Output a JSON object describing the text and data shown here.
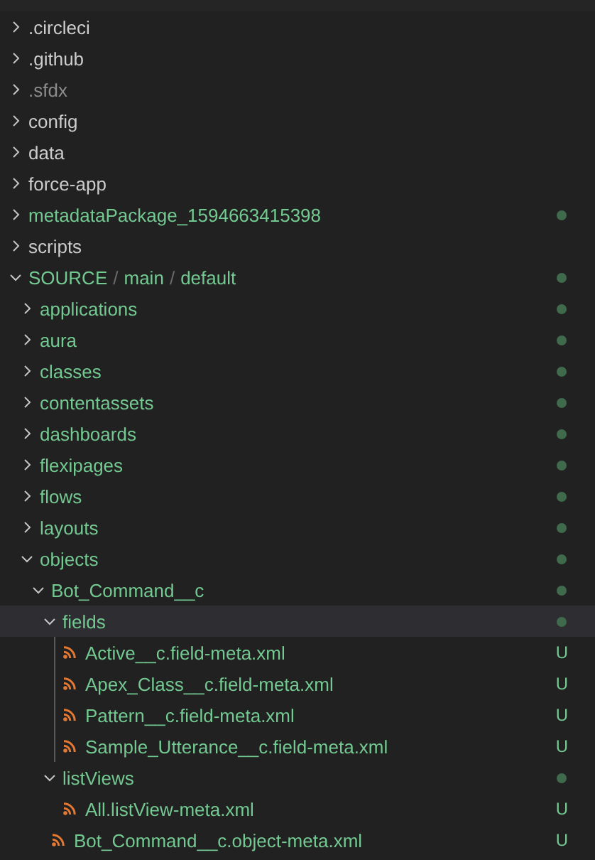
{
  "tree": [
    {
      "kind": "folder",
      "label": ".circleci",
      "untracked": false,
      "ignored": false,
      "expanded": false,
      "selected": false,
      "dot": false
    },
    {
      "kind": "folder",
      "label": ".github",
      "untracked": false,
      "ignored": false,
      "expanded": false,
      "selected": false,
      "dot": false
    },
    {
      "kind": "folder",
      "label": ".sfdx",
      "ignored": true,
      "expanded": false,
      "selected": false,
      "dot": false
    },
    {
      "kind": "folder",
      "label": "config",
      "untracked": false,
      "ignored": false,
      "expanded": false,
      "selected": false,
      "dot": false
    },
    {
      "kind": "folder",
      "label": "data",
      "untracked": false,
      "ignored": false,
      "expanded": false,
      "selected": false,
      "dot": false
    },
    {
      "kind": "folder",
      "label": "force-app",
      "untracked": false,
      "ignored": false,
      "expanded": false,
      "selected": false,
      "dot": false
    },
    {
      "kind": "folder",
      "label": "metadataPackage_1594663415398",
      "untracked": true,
      "ignored": false,
      "expanded": false,
      "selected": false,
      "dot": true
    },
    {
      "kind": "folder",
      "label": "scripts",
      "untracked": false,
      "ignored": false,
      "expanded": false,
      "selected": false,
      "dot": false
    },
    {
      "kind": "folder",
      "parts": [
        {
          "text": "SOURCE",
          "kind": "name"
        },
        {
          "text": "/",
          "kind": "separator"
        },
        {
          "text": "main",
          "kind": "name"
        },
        {
          "text": "/",
          "kind": "separator"
        },
        {
          "text": "default",
          "kind": "name"
        }
      ],
      "untracked": true,
      "ignored": false,
      "expanded": true,
      "selected": false,
      "dot": true,
      "children": [
        {
          "kind": "folder",
          "label": "applications",
          "untracked": true,
          "ignored": false,
          "expanded": false,
          "selected": false,
          "dot": true
        },
        {
          "kind": "folder",
          "label": "aura",
          "untracked": true,
          "ignored": false,
          "expanded": false,
          "selected": false,
          "dot": true
        },
        {
          "kind": "folder",
          "label": "classes",
          "untracked": true,
          "ignored": false,
          "expanded": false,
          "selected": false,
          "dot": true
        },
        {
          "kind": "folder",
          "label": "contentassets",
          "untracked": true,
          "ignored": false,
          "expanded": false,
          "selected": false,
          "dot": true
        },
        {
          "kind": "folder",
          "label": "dashboards",
          "untracked": true,
          "ignored": false,
          "expanded": false,
          "selected": false,
          "dot": true
        },
        {
          "kind": "folder",
          "label": "flexipages",
          "untracked": true,
          "ignored": false,
          "expanded": false,
          "selected": false,
          "dot": true
        },
        {
          "kind": "folder",
          "label": "flows",
          "untracked": true,
          "ignored": false,
          "expanded": false,
          "selected": false,
          "dot": true
        },
        {
          "kind": "folder",
          "label": "layouts",
          "untracked": true,
          "ignored": false,
          "expanded": false,
          "selected": false,
          "dot": true
        },
        {
          "kind": "folder",
          "label": "objects",
          "untracked": true,
          "ignored": false,
          "expanded": true,
          "selected": false,
          "dot": true,
          "children": [
            {
              "kind": "folder",
              "label": "Bot_Command__c",
              "untracked": true,
              "ignored": false,
              "expanded": true,
              "selected": false,
              "dot": true,
              "children": [
                {
                  "kind": "folder",
                  "label": "fields",
                  "untracked": true,
                  "ignored": false,
                  "expanded": true,
                  "selected": true,
                  "dot": true,
                  "children": [
                    {
                      "kind": "file",
                      "label": "Active__c.field-meta.xml",
                      "untracked": true,
                      "ignored": false,
                      "badge": "U"
                    },
                    {
                      "kind": "file",
                      "label": "Apex_Class__c.field-meta.xml",
                      "untracked": true,
                      "ignored": false,
                      "badge": "U"
                    },
                    {
                      "kind": "file",
                      "label": "Pattern__c.field-meta.xml",
                      "untracked": true,
                      "ignored": false,
                      "badge": "U"
                    },
                    {
                      "kind": "file",
                      "label": "Sample_Utterance__c.field-meta.xml",
                      "untracked": true,
                      "ignored": false,
                      "badge": "U"
                    }
                  ]
                },
                {
                  "kind": "folder",
                  "label": "listViews",
                  "untracked": true,
                  "ignored": false,
                  "expanded": true,
                  "selected": false,
                  "dot": true,
                  "children": [
                    {
                      "kind": "file",
                      "label": "All.listView-meta.xml",
                      "untracked": true,
                      "ignored": false,
                      "badge": "U"
                    }
                  ]
                },
                {
                  "kind": "file",
                  "label": "Bot_Command__c.object-meta.xml",
                  "untracked": true,
                  "ignored": false,
                  "badge": "U"
                }
              ]
            }
          ]
        }
      ]
    }
  ]
}
